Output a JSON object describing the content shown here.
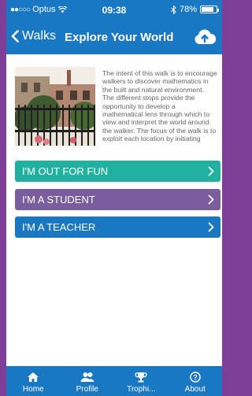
{
  "status_bar": {
    "signal": "●●○○○",
    "carrier": "Optus",
    "time": "09:38",
    "battery": "78%",
    "battery_level": 0.78
  },
  "nav": {
    "back_label": "Walks",
    "title": "Explore Your World",
    "upload_icon": "cloud-upload-icon"
  },
  "intro": {
    "text": "The intent of this walk is to encourage walkers to discover mathematics in the built and natural environment. The different stops provide the opportunity to develop a mathematical lens through which to view and interpret the world around the walker. The focus of the walk is to exploit each location by initiating"
  },
  "buttons": [
    {
      "label": "I'M OUT FOR FUN",
      "color": "#22b1a0"
    },
    {
      "label": "I'M A STUDENT",
      "color": "#7a5d9d"
    },
    {
      "label": "I'M A TEACHER",
      "color": "#1a78c2"
    }
  ],
  "tabs": [
    {
      "label": "Home",
      "icon": "home-icon"
    },
    {
      "label": "Profile",
      "icon": "users-icon"
    },
    {
      "label": "Trophi...",
      "icon": "trophy-icon"
    },
    {
      "label": "About",
      "icon": "question-icon"
    }
  ],
  "colors": {
    "primary": "#1a78c2",
    "background": "#7d3f98"
  }
}
